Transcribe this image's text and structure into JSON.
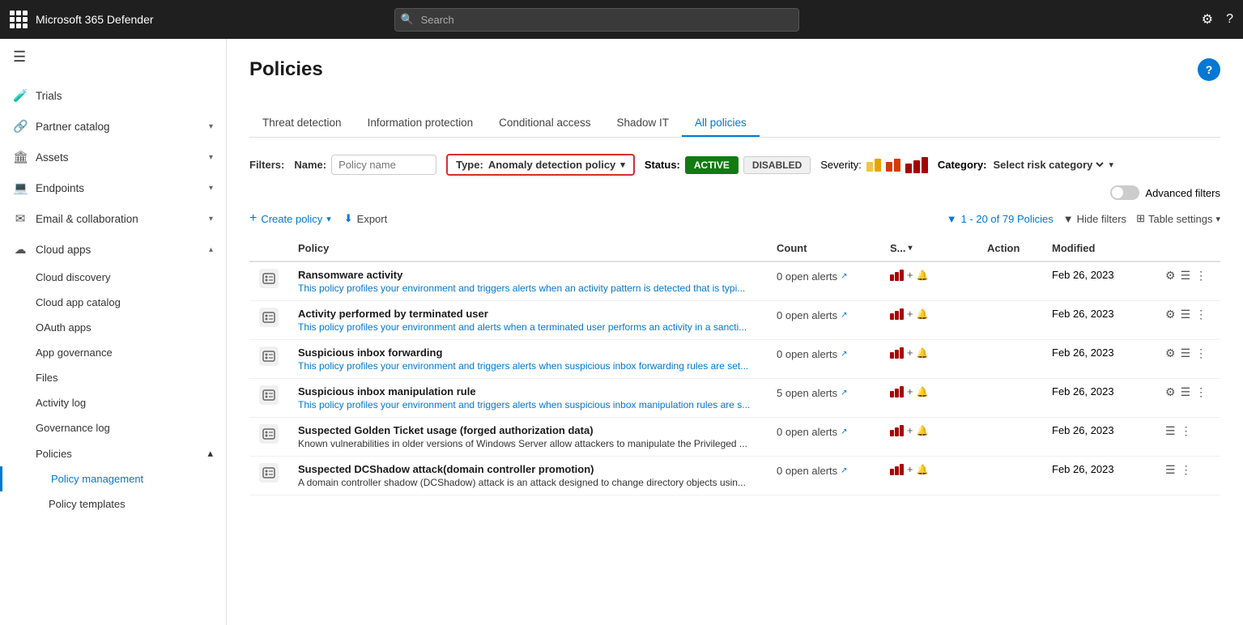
{
  "topbar": {
    "app_name": "Microsoft 365 Defender",
    "search_placeholder": "Search"
  },
  "sidebar": {
    "hamburger": "☰",
    "items": [
      {
        "id": "trials",
        "label": "Trials",
        "icon": "🧪",
        "expandable": false
      },
      {
        "id": "partner-catalog",
        "label": "Partner catalog",
        "icon": "🔗",
        "expandable": true
      },
      {
        "id": "assets",
        "label": "Assets",
        "icon": "🏛",
        "expandable": true
      },
      {
        "id": "endpoints",
        "label": "Endpoints",
        "icon": "💻",
        "expandable": true
      },
      {
        "id": "email-collab",
        "label": "Email & collaboration",
        "icon": "✉",
        "expandable": true
      },
      {
        "id": "cloud-apps",
        "label": "Cloud apps",
        "icon": "☁",
        "expandable": true,
        "expanded": true
      }
    ],
    "cloud_apps_subitems": [
      {
        "id": "cloud-discovery",
        "label": "Cloud discovery"
      },
      {
        "id": "cloud-app-catalog",
        "label": "Cloud app catalog"
      },
      {
        "id": "oauth-apps",
        "label": "OAuth apps"
      },
      {
        "id": "app-governance",
        "label": "App governance"
      },
      {
        "id": "files",
        "label": "Files"
      },
      {
        "id": "activity-log",
        "label": "Activity log"
      },
      {
        "id": "governance-log",
        "label": "Governance log"
      },
      {
        "id": "policies",
        "label": "Policies",
        "expandable": true,
        "expanded": true
      }
    ],
    "policies_subitems": [
      {
        "id": "policy-management",
        "label": "Policy management",
        "active": true
      },
      {
        "id": "policy-templates",
        "label": "Policy templates"
      }
    ]
  },
  "page": {
    "title": "Policies",
    "help_icon": "?"
  },
  "tabs": [
    {
      "id": "threat-detection",
      "label": "Threat detection",
      "active": false
    },
    {
      "id": "information-protection",
      "label": "Information protection",
      "active": false
    },
    {
      "id": "conditional-access",
      "label": "Conditional access",
      "active": false
    },
    {
      "id": "shadow-it",
      "label": "Shadow IT",
      "active": false
    },
    {
      "id": "all-policies",
      "label": "All policies",
      "active": true
    }
  ],
  "filters": {
    "label": "Filters:",
    "name_label": "Name:",
    "name_placeholder": "Policy name",
    "type_label": "Type:",
    "type_value": "Anomaly detection policy",
    "status_label": "Status:",
    "status_active": "ACTIVE",
    "status_disabled": "DISABLED",
    "severity_label": "Severity:",
    "category_label": "Category:",
    "category_value": "Select risk category",
    "advanced_filters": "Advanced filters"
  },
  "toolbar": {
    "create_label": "Create policy",
    "export_label": "Export",
    "policy_count": "1 - 20 of 79 Policies",
    "hide_filters": "Hide filters",
    "table_settings": "Table settings"
  },
  "table": {
    "columns": [
      "",
      "Policy",
      "Count",
      "S...",
      "Action",
      "Modified"
    ],
    "rows": [
      {
        "id": 1,
        "name": "Ransomware activity",
        "desc": "This policy profiles your environment and triggers alerts when an activity pattern is detected that is typi...",
        "desc_color": "blue",
        "count": "0 open alerts",
        "modified": "Feb 26, 2023"
      },
      {
        "id": 2,
        "name": "Activity performed by terminated user",
        "desc": "This policy profiles your environment and alerts when a terminated user performs an activity in a sancti...",
        "desc_color": "blue",
        "count": "0 open alerts",
        "modified": "Feb 26, 2023"
      },
      {
        "id": 3,
        "name": "Suspicious inbox forwarding",
        "desc": "This policy profiles your environment and triggers alerts when suspicious inbox forwarding rules are set...",
        "desc_color": "blue",
        "count": "0 open alerts",
        "modified": "Feb 26, 2023"
      },
      {
        "id": 4,
        "name": "Suspicious inbox manipulation rule",
        "desc": "This policy profiles your environment and triggers alerts when suspicious inbox manipulation rules are s...",
        "desc_color": "blue",
        "count": "5 open alerts",
        "modified": "Feb 26, 2023"
      },
      {
        "id": 5,
        "name": "Suspected Golden Ticket usage (forged authorization data)",
        "desc": "Known vulnerabilities in older versions of Windows Server allow attackers to manipulate the Privileged ...",
        "desc_color": "dark",
        "count": "0 open alerts",
        "modified": "Feb 26, 2023"
      },
      {
        "id": 6,
        "name": "Suspected DCShadow attack(domain controller promotion)",
        "desc": "A domain controller shadow (DCShadow) attack is an attack designed to change directory objects usin...",
        "desc_color": "dark",
        "count": "0 open alerts",
        "modified": "Feb 26, 2023"
      }
    ]
  }
}
